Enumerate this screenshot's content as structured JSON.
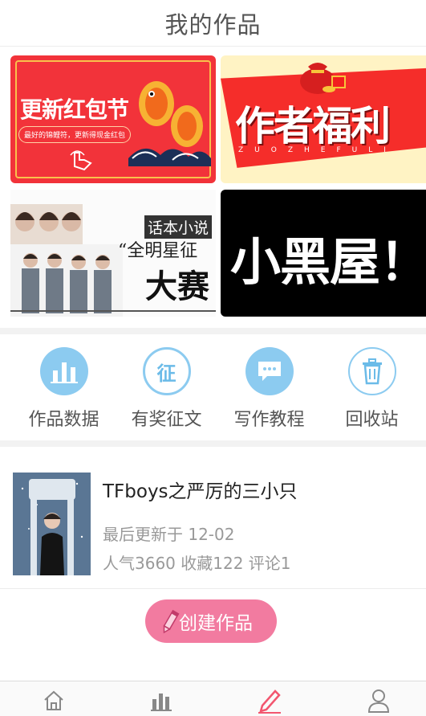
{
  "header": {
    "title": "我的作品"
  },
  "banners": {
    "red_packet": {
      "title": "更新红包节",
      "subtitle": "最好的锦鲤符，更新得现金红包"
    },
    "welfare": {
      "title": "作者福利",
      "pinyin": "ZUOZHEFULI"
    },
    "star_contest": {
      "tag": "话本小说",
      "line1": "“全明星征",
      "line2": "大赛"
    },
    "black_room": {
      "title": "小黑屋！"
    }
  },
  "actions": [
    {
      "label": "作品数据",
      "icon": "bar-chart-icon",
      "color": "#8ccbf0"
    },
    {
      "label": "有奖征文",
      "icon": "contest-icon",
      "color": "#8ccbf0",
      "glyph": "征"
    },
    {
      "label": "写作教程",
      "icon": "chat-bubble-icon",
      "color": "#8ccbf0"
    },
    {
      "label": "回收站",
      "icon": "trash-icon",
      "color": "#8ccbf0"
    }
  ],
  "work": {
    "title": "TFboys之严厉的三小只",
    "updated": "最后更新于 12-02",
    "stats": "人气3660 收藏122 评论1"
  },
  "create_button": {
    "label": "创建作品",
    "color": "#f27ba0"
  },
  "tabbar": {
    "tabs": [
      {
        "icon": "home-icon",
        "active": false
      },
      {
        "icon": "bar-chart-icon",
        "active": false
      },
      {
        "icon": "pencil-icon",
        "active": true
      },
      {
        "icon": "user-icon",
        "active": false
      }
    ],
    "active_color": "#f2566f"
  }
}
